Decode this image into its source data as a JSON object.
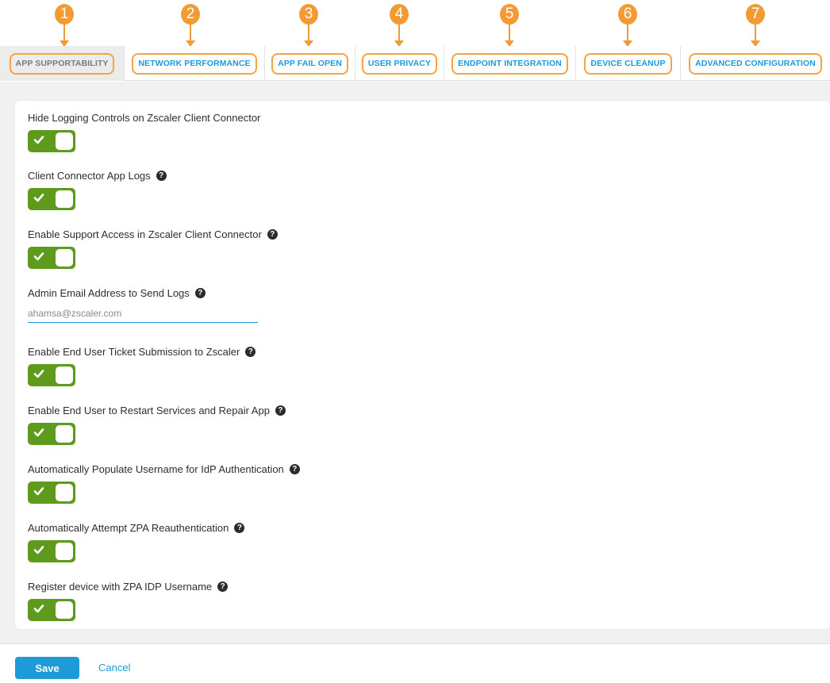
{
  "callouts": [
    "1",
    "2",
    "3",
    "4",
    "5",
    "6",
    "7"
  ],
  "tabs": [
    {
      "label": "APP SUPPORTABILITY",
      "active": true
    },
    {
      "label": "NETWORK PERFORMANCE",
      "active": false
    },
    {
      "label": "APP FAIL OPEN",
      "active": false
    },
    {
      "label": "USER PRIVACY",
      "active": false
    },
    {
      "label": "ENDPOINT INTEGRATION",
      "active": false
    },
    {
      "label": "DEVICE CLEANUP",
      "active": false
    },
    {
      "label": "ADVANCED CONFIGURATION",
      "active": false
    }
  ],
  "settings": [
    {
      "label": "Hide Logging Controls on Zscaler Client Connector",
      "help": false,
      "enabled": true
    },
    {
      "label": "Client Connector App Logs",
      "help": true,
      "enabled": true
    },
    {
      "label": "Enable Support Access in Zscaler Client Connector",
      "help": true,
      "enabled": true
    },
    {
      "label": "Admin Email Address to Send Logs",
      "help": true,
      "email_value": "ahamsa@zscaler.com"
    },
    {
      "label": "Enable End User Ticket Submission to Zscaler",
      "help": true,
      "enabled": true
    },
    {
      "label": "Enable End User to Restart Services and Repair App",
      "help": true,
      "enabled": true
    },
    {
      "label": "Automatically Populate Username for IdP Authentication",
      "help": true,
      "enabled": true
    },
    {
      "label": "Automatically Attempt ZPA Reauthentication",
      "help": true,
      "enabled": true
    },
    {
      "label": "Register device with ZPA IDP Username",
      "help": true,
      "enabled": true
    }
  ],
  "help_glyph": "?",
  "footer": {
    "save_label": "Save",
    "cancel_label": "Cancel"
  },
  "colors": {
    "accent": "#1d9ad6",
    "toggle_on": "#5e9b1c",
    "callout": "#f29b35"
  }
}
